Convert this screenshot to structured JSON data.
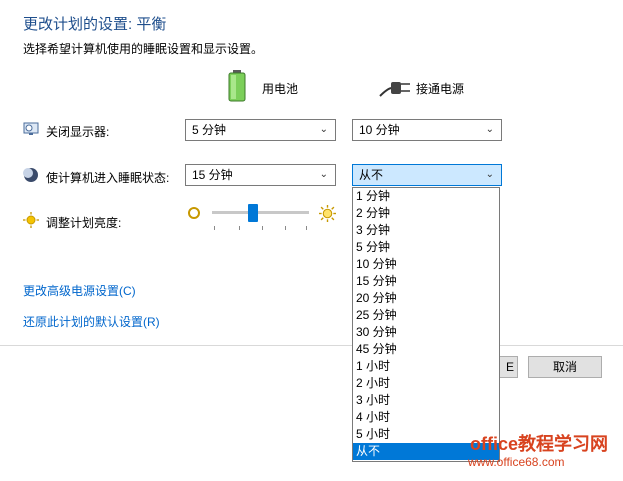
{
  "header": {
    "title": "更改计划的设置: 平衡",
    "subtitle": "选择希望计算机使用的睡眠设置和显示设置。"
  },
  "columns": {
    "battery": "用电池",
    "plugged_in": "接通电源"
  },
  "rows": {
    "display_off": {
      "label": "关闭显示器:",
      "battery_value": "5 分钟",
      "plugged_value": "10 分钟"
    },
    "sleep": {
      "label": "使计算机进入睡眠状态:",
      "battery_value": "15 分钟",
      "plugged_value": "从不"
    },
    "brightness": {
      "label": "调整计划亮度:",
      "battery_level_percent": 50
    }
  },
  "dropdown_options": [
    "1 分钟",
    "2 分钟",
    "3 分钟",
    "5 分钟",
    "10 分钟",
    "15 分钟",
    "20 分钟",
    "25 分钟",
    "30 分钟",
    "45 分钟",
    "1 小时",
    "2 小时",
    "3 小时",
    "4 小时",
    "5 小时",
    "从不"
  ],
  "links": {
    "advanced": "更改高级电源设置(C)",
    "restore": "还原此计划的默认设置(R)"
  },
  "buttons": {
    "save_partial": "E",
    "cancel": "取消"
  },
  "watermark": {
    "line1": "office教程学习网",
    "line2": "www.office68.com"
  },
  "colors": {
    "title": "#1e4e8c",
    "link": "#0066cc",
    "accent": "#0078d7"
  }
}
